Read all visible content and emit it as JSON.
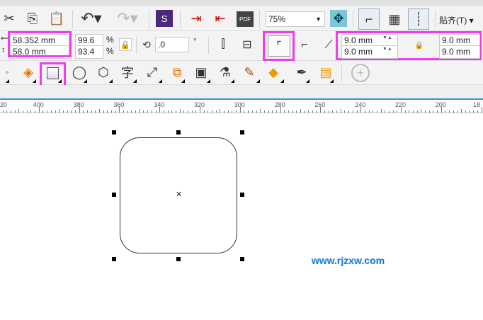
{
  "toolbar": {
    "zoom_value": "75%",
    "snap_label": "贴齐(T)"
  },
  "property_bar": {
    "width": "58.352 mm",
    "height": "58.0 mm",
    "scale_x": "99.6",
    "scale_y": "93.4",
    "percent": "%",
    "rotation": ".0",
    "degree": "°",
    "corner_tl": "9.0 mm",
    "corner_bl": "9.0 mm",
    "corner_tr": "9.0 mm",
    "corner_br": "9.0 mm"
  },
  "tools": {
    "text_tool": "字"
  },
  "ruler": {
    "labels": [
      "20",
      "400",
      "380",
      "360",
      "340",
      "320",
      "300",
      "280",
      "260",
      "240",
      "220",
      "200",
      "18"
    ]
  },
  "watermark": "www.rjzxw.com",
  "colors": {
    "highlight": "#f03cf0",
    "watermark": "#1a7fd4",
    "ruler_line": "#2a9ad8"
  }
}
